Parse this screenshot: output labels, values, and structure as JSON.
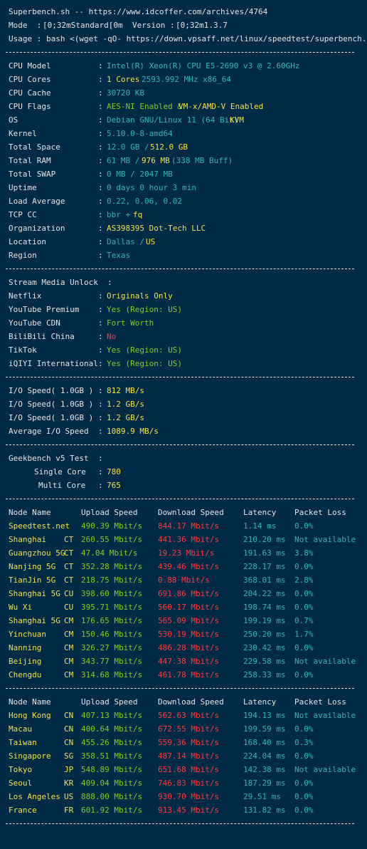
{
  "header": {
    "title": "Superbench.sh -- https://www.idcoffer.com/archives/4764",
    "mode_label": "Mode  : ",
    "mode_value": "[0;32mStandard[0m",
    "version_label": "Version : ",
    "version_value": "[0;32m1.3.7",
    "usage": "Usage : bash <(wget -qO- https://down.vpsaff.net/linux/speedtest/superbench.sh)"
  },
  "separator": "----------------------------------------------------------------------",
  "colon": ":",
  "sysinfo": {
    "cpu_model": {
      "label": "CPU Model",
      "value": "Intel(R) Xeon(R) CPU E5-2690 v3 @ 2.60GHz"
    },
    "cpu_cores": {
      "label": "CPU Cores",
      "v1": "1 Cores",
      "v2": "2593.992 MHz x86_64"
    },
    "cpu_cache": {
      "label": "CPU Cache",
      "value": "30720 KB"
    },
    "cpu_flags": {
      "label": "CPU Flags",
      "v1": "AES-NI Enabled &",
      "v2": "VM-x/AMD-V Enabled"
    },
    "os": {
      "label": "OS",
      "v1": "Debian GNU/Linux 11 (64 Bit)",
      "v2": "KVM"
    },
    "kernel": {
      "label": "Kernel",
      "value": "5.10.0-8-amd64"
    },
    "total_space": {
      "label": "Total Space",
      "v1": "12.0 GB /",
      "v2": "512.0 GB"
    },
    "total_ram": {
      "label": "Total RAM",
      "v1": "61 MB /",
      "v2": "976 MB",
      "v3": "(338 MB Buff)"
    },
    "total_swap": {
      "label": "Total SWAP",
      "value": "0 MB / 2047 MB"
    },
    "uptime": {
      "label": "Uptime",
      "value": "0 days 0 hour 3 min"
    },
    "load_average": {
      "label": "Load Average",
      "value": "0.22, 0.06, 0.02"
    },
    "tcp_cc": {
      "label": "TCP CC",
      "v1": "bbr +",
      "v2": "fq"
    },
    "organization": {
      "label": "Organization",
      "value": "AS398395 Dot-Tech LLC"
    },
    "location": {
      "label": "Location",
      "v1": "Dallas /",
      "v2": "US"
    },
    "region": {
      "label": "Region",
      "value": "Texas"
    }
  },
  "stream": {
    "title": "Stream Media Unlock  :",
    "netflix": {
      "label": "Netflix",
      "value": "Originals Only"
    },
    "youtube_premium": {
      "label": "YouTube Premium",
      "value": "Yes (Region: US)"
    },
    "youtube_cdn": {
      "label": "YouTube CDN",
      "value": "Fort Worth"
    },
    "bilibili": {
      "label": "BiliBili China",
      "value": "No"
    },
    "tiktok": {
      "label": "TikTok",
      "value": "Yes (Region: US)"
    },
    "iqiyi": {
      "label": "iQIYI International",
      "value": "Yes (Region: US)"
    }
  },
  "io": {
    "run1": {
      "label": "I/O Speed( 1.0GB )",
      "value": "812 MB/s"
    },
    "run2": {
      "label": "I/O Speed( 1.0GB )",
      "value": "1.2 GB/s"
    },
    "run3": {
      "label": "I/O Speed( 1.0GB )",
      "value": "1.2 GB/s"
    },
    "average": {
      "label": "Average I/O Speed",
      "value": "1089.9 MB/s"
    }
  },
  "geekbench": {
    "title": "Geekbench v5 Test",
    "single": {
      "label": "Single Core",
      "value": "780"
    },
    "multi": {
      "label": "Multi Core",
      "value": "765"
    }
  },
  "speed_headers": {
    "node": "Node Name",
    "upload": "Upload Speed",
    "download": "Download Speed",
    "latency": "Latency",
    "loss": "Packet Loss"
  },
  "speedtest_cn": [
    {
      "name": "Speedtest.net",
      "isp": "",
      "up": "490.39 Mbit/s",
      "down": "844.17 Mbit/s",
      "lat": "1.14 ms",
      "loss": "0.0%"
    },
    {
      "name": "Shanghai",
      "isp": "CT",
      "up": "260.55 Mbit/s",
      "down": "441.36 Mbit/s",
      "lat": "210.20 ms",
      "loss": "Not available"
    },
    {
      "name": "Guangzhou 5G",
      "isp": "CT",
      "up": "47.04 Mbit/s",
      "down": "19.23 Mbit/s",
      "lat": "191.63 ms",
      "loss": "3.8%"
    },
    {
      "name": "Nanjing 5G",
      "isp": "CT",
      "up": "352.28 Mbit/s",
      "down": "439.46 Mbit/s",
      "lat": "228.17 ms",
      "loss": "0.0%"
    },
    {
      "name": "TianJin 5G",
      "isp": "CT",
      "up": "218.75 Mbit/s",
      "down": "0.88 Mbit/s",
      "lat": "368.01 ms",
      "loss": "2.8%"
    },
    {
      "name": "Shanghai 5G",
      "isp": "CU",
      "up": "398.60 Mbit/s",
      "down": "691.86 Mbit/s",
      "lat": "204.22 ms",
      "loss": "0.0%"
    },
    {
      "name": "Wu Xi",
      "isp": "CU",
      "up": "395.71 Mbit/s",
      "down": "560.17 Mbit/s",
      "lat": "198.74 ms",
      "loss": "0.0%"
    },
    {
      "name": "Shanghai 5G",
      "isp": "CM",
      "up": "176.65 Mbit/s",
      "down": "565.09 Mbit/s",
      "lat": "199.19 ms",
      "loss": "0.7%"
    },
    {
      "name": "Yinchuan",
      "isp": "CM",
      "up": "150.46 Mbit/s",
      "down": "530.19 Mbit/s",
      "lat": "250.20 ms",
      "loss": "1.7%"
    },
    {
      "name": "Nanning",
      "isp": "CM",
      "up": "326.27 Mbit/s",
      "down": "486.28 Mbit/s",
      "lat": "230.42 ms",
      "loss": "0.0%"
    },
    {
      "name": "Beijing",
      "isp": "CM",
      "up": "343.77 Mbit/s",
      "down": "447.38 Mbit/s",
      "lat": "229.58 ms",
      "loss": "Not available"
    },
    {
      "name": "Chengdu",
      "isp": "CM",
      "up": "314.68 Mbit/s",
      "down": "461.78 Mbit/s",
      "lat": "258.33 ms",
      "loss": "0.0%"
    }
  ],
  "speedtest_intl": [
    {
      "name": "Hong Kong",
      "isp": "CN",
      "up": "407.13 Mbit/s",
      "down": "562.63 Mbit/s",
      "lat": "194.13 ms",
      "loss": "Not available"
    },
    {
      "name": "Macau",
      "isp": "CN",
      "up": "400.64 Mbit/s",
      "down": "672.55 Mbit/s",
      "lat": "199.59 ms",
      "loss": "0.0%"
    },
    {
      "name": "Taiwan",
      "isp": "CN",
      "up": "455.26 Mbit/s",
      "down": "559.36 Mbit/s",
      "lat": "168.40 ms",
      "loss": "0.3%"
    },
    {
      "name": "Singapore",
      "isp": "SG",
      "up": "358.51 Mbit/s",
      "down": "487.14 Mbit/s",
      "lat": "224.04 ms",
      "loss": "0.0%"
    },
    {
      "name": "Tokyo",
      "isp": "JP",
      "up": "548.89 Mbit/s",
      "down": "651.68 Mbit/s",
      "lat": "142.38 ms",
      "loss": "Not available"
    },
    {
      "name": "Seoul",
      "isp": "KR",
      "up": "409.04 Mbit/s",
      "down": "746.83 Mbit/s",
      "lat": "187.29 ms",
      "loss": "0.0%"
    },
    {
      "name": "Los Angeles",
      "isp": "US",
      "up": "888.00 Mbit/s",
      "down": "930.70 Mbit/s",
      "lat": "29.51 ms",
      "loss": "0.0%"
    },
    {
      "name": "France",
      "isp": "FR",
      "up": "601.92 Mbit/s",
      "down": "913.45 Mbit/s",
      "lat": "131.82 ms",
      "loss": "0.0%"
    }
  ],
  "colors": {
    "background": "#012a47",
    "text": "#e6e6e6",
    "cyan": "#2fb8b5",
    "yellow": "#f4e24a",
    "green": "#7ed321",
    "red": "#ff3b3b"
  }
}
